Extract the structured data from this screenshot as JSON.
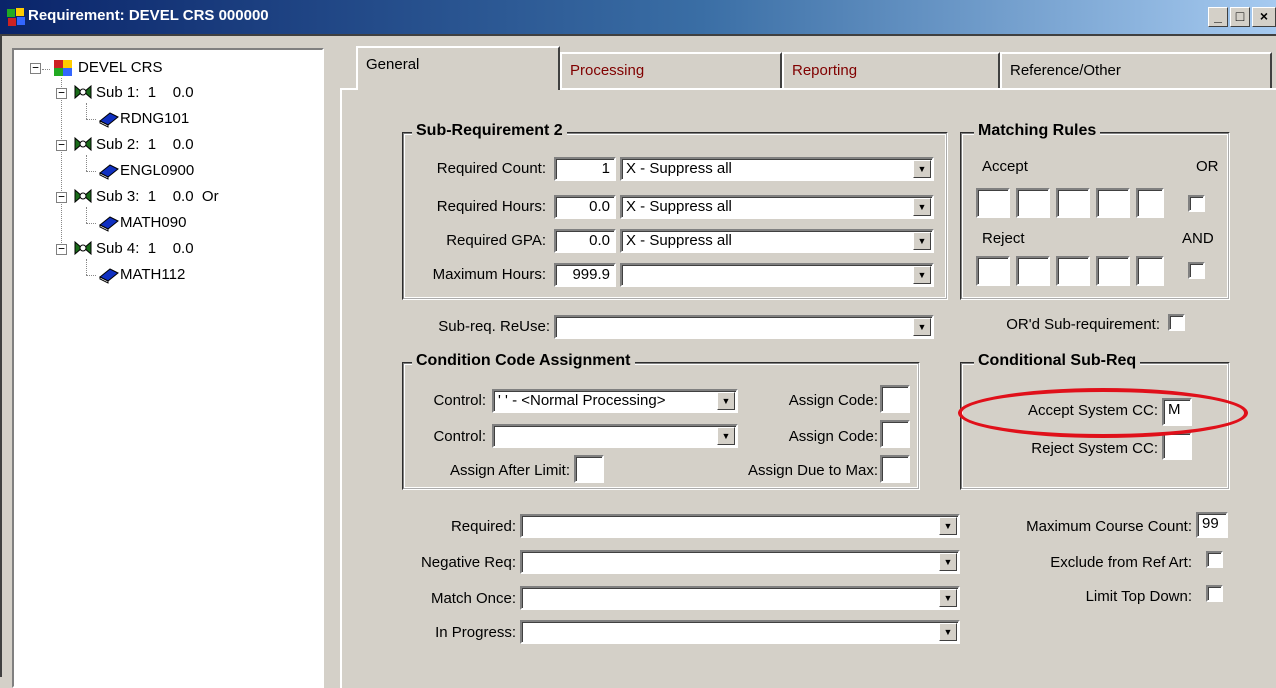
{
  "window": {
    "title": "Requirement: DEVEL CRS 000000",
    "buttons": [
      "_",
      "□",
      "×"
    ]
  },
  "tree": {
    "root_label": "DEVEL CRS",
    "nodes": [
      {
        "label": "Sub 1:  1    0.0",
        "child": "RDNG101"
      },
      {
        "label": "Sub 2:  1    0.0",
        "child": "ENGL0900"
      },
      {
        "label": "Sub 3:  1    0.0  Or",
        "child": "MATH090"
      },
      {
        "label": "Sub 4:  1    0.0",
        "child": "MATH112"
      }
    ]
  },
  "tabs": [
    {
      "label": "General",
      "active": true
    },
    {
      "label": "Processing",
      "active": false
    },
    {
      "label": "Reporting",
      "active": false
    },
    {
      "label": "Reference/Other",
      "active": false
    }
  ],
  "subreq": {
    "legend": "Sub-Requirement 2",
    "rows": [
      {
        "label": "Required Count:",
        "value": "1",
        "combo": "X - Suppress all"
      },
      {
        "label": "Required Hours:",
        "value": "0.0",
        "combo": "X - Suppress all"
      },
      {
        "label": "Required GPA:",
        "value": "0.0",
        "combo": "X - Suppress all"
      },
      {
        "label": "Maximum Hours:",
        "value": "999.9",
        "combo": ""
      }
    ]
  },
  "matching": {
    "legend": "Matching Rules",
    "accept_label": "Accept",
    "or_label": "OR",
    "reject_label": "Reject",
    "and_label": "AND"
  },
  "reuse": {
    "label": "Sub-req. ReUse:",
    "value": ""
  },
  "ord": {
    "label": "OR'd Sub-requirement:"
  },
  "condition": {
    "legend": "Condition Code Assignment",
    "control1_label": "Control:",
    "control1_value": "' ' - <Normal Processing>",
    "assign1_label": "Assign Code:",
    "control2_label": "Control:",
    "control2_value": "",
    "assign2_label": "Assign Code:",
    "after_limit_label": "Assign After Limit:",
    "due_max_label": "Assign Due to Max:"
  },
  "conditional": {
    "legend": "Conditional Sub-Req",
    "accept_label": "Accept System CC:",
    "accept_value": "M",
    "reject_label": "Reject System CC:",
    "reject_value": ""
  },
  "lower": {
    "required_label": "Required:",
    "negative_label": "Negative Req:",
    "match_once_label": "Match Once:",
    "in_progress_label": "In Progress:",
    "max_course_label": "Maximum Course Count:",
    "max_course_value": "99",
    "exclude_label": "Exclude from Ref Art:",
    "limit_label": "Limit Top Down:"
  },
  "colors": {
    "highlight": "#e0101a",
    "tab_text_inactive": "#800000",
    "titlebar_start": "#0a246a"
  }
}
